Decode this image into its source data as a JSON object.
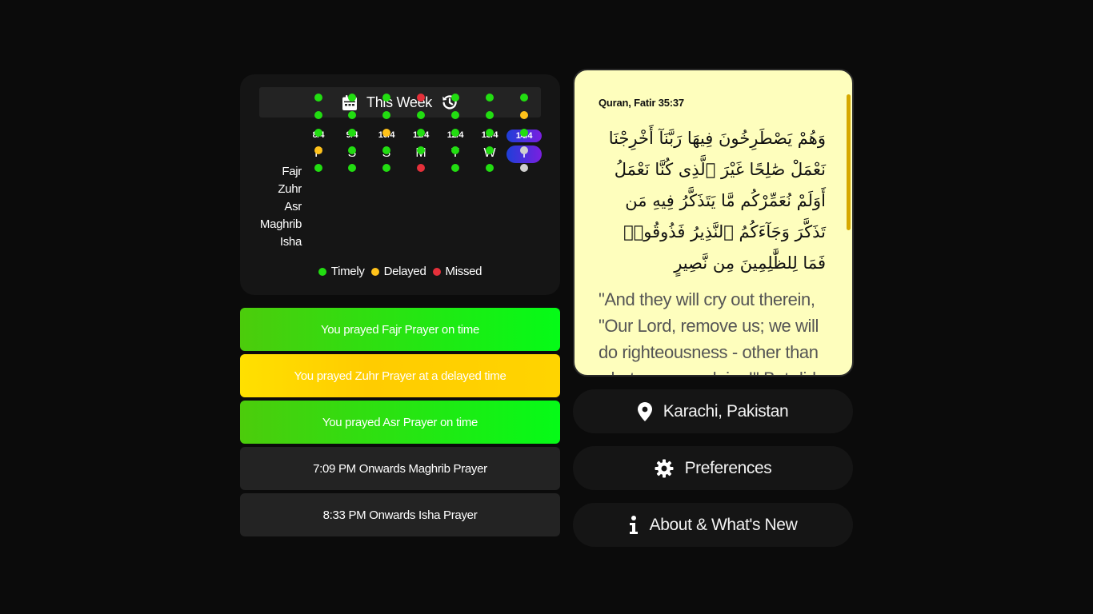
{
  "week": {
    "title": "This Week",
    "dates": [
      "8/4",
      "9/4",
      "10/4",
      "11/4",
      "12/4",
      "13/4",
      "14/4"
    ],
    "days": [
      "F",
      "S",
      "S",
      "M",
      "T",
      "W",
      "T"
    ],
    "today_index": 6,
    "prayers": [
      "Fajr",
      "Zuhr",
      "Asr",
      "Maghrib",
      "Isha"
    ],
    "status": [
      [
        "timely",
        "timely",
        "timely",
        "missed",
        "timely",
        "timely",
        "timely"
      ],
      [
        "timely",
        "timely",
        "timely",
        "timely",
        "timely",
        "timely",
        "delayed"
      ],
      [
        "timely",
        "timely",
        "delayed",
        "timely",
        "timely",
        "timely",
        "timely"
      ],
      [
        "delayed",
        "timely",
        "timely",
        "timely",
        "timely",
        "timely",
        "pending"
      ],
      [
        "timely",
        "timely",
        "timely",
        "missed",
        "timely",
        "timely",
        "pending"
      ]
    ],
    "legend": {
      "timely": "Timely",
      "delayed": "Delayed",
      "missed": "Missed"
    }
  },
  "colors": {
    "timely": "#22dd11",
    "delayed": "#ffc21a",
    "missed": "#e5303a",
    "pending": "#cfcfcf",
    "today_gradient_start": "#1e3fd8",
    "today_gradient_end": "#7a1fe0",
    "verse_bg": "#fefebd"
  },
  "prayer_buttons": [
    {
      "label": "You prayed Fajr Prayer on time",
      "state": "timely"
    },
    {
      "label": "You prayed Zuhr Prayer at a delayed time",
      "state": "delayed"
    },
    {
      "label": "You prayed Asr Prayer on time",
      "state": "timely"
    },
    {
      "label": "7:09 PM Onwards Maghrib Prayer",
      "state": "upcoming"
    },
    {
      "label": "8:33 PM Onwards Isha Prayer",
      "state": "upcoming"
    }
  ],
  "verse": {
    "reference": "Quran, Fatir 35:37",
    "arabic": "وَهُمْ يَصْطَرِخُونَ فِيهَا رَبَّنَآ أَخْرِجْنَا نَعْمَلْ صَٰلِحًا غَيْرَ ٱلَّذِى كُنَّا نَعْمَلُ أَوَلَمْ نُعَمِّرْكُم مَّا يَتَذَكَّرُ فِيهِ مَن تَذَكَّرَ وَجَآءَكُمُ ٱلنَّذِيرُ فَذُوقُوا۟ فَمَا لِلظَّٰلِمِينَ مِن نَّصِيرٍ",
    "translation": "\"And they will cry out therein, \"Our Lord, remove us; we will do righteousness - other than what we were doing!\" But did"
  },
  "menu": {
    "location": "Karachi, Pakistan",
    "preferences": "Preferences",
    "about": "About & What's New"
  },
  "icons": {
    "header_left": "calendar-icon",
    "header_right": "history-icon",
    "location": "location-pin-icon",
    "preferences": "gear-icon",
    "about": "info-icon"
  }
}
